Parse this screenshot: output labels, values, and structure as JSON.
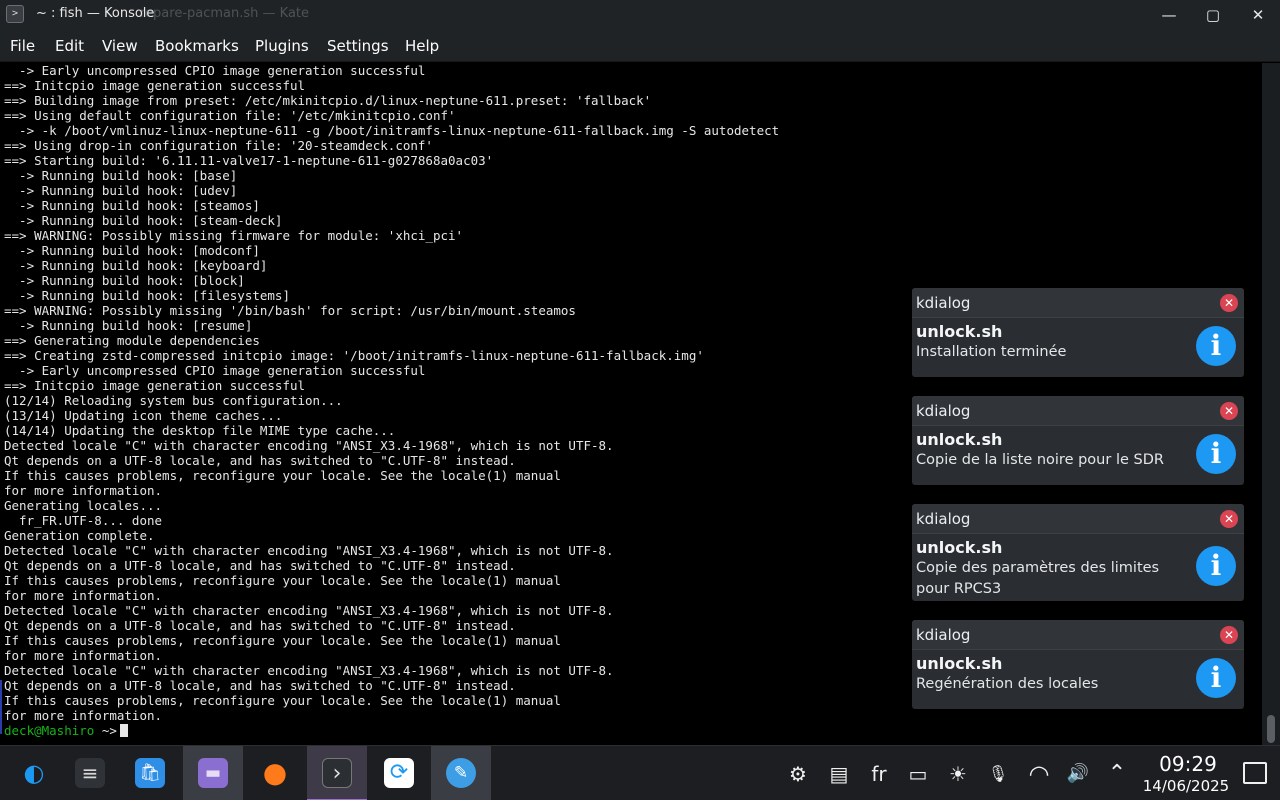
{
  "window": {
    "title": "~ : fish — Konsole",
    "background_title": "repare-pacman.sh — Kate",
    "controls": {
      "minimize": "—",
      "maximize": "▢",
      "close": "✕"
    }
  },
  "menu": [
    "File",
    "Edit",
    "View",
    "Bookmarks",
    "Plugins",
    "Settings",
    "Help"
  ],
  "terminal": {
    "lines": [
      "  -> Early uncompressed CPIO image generation successful",
      "==> Initcpio image generation successful",
      "==> Building image from preset: /etc/mkinitcpio.d/linux-neptune-611.preset: 'fallback'",
      "==> Using default configuration file: '/etc/mkinitcpio.conf'",
      "  -> -k /boot/vmlinuz-linux-neptune-611 -g /boot/initramfs-linux-neptune-611-fallback.img -S autodetect",
      "==> Using drop-in configuration file: '20-steamdeck.conf'",
      "==> Starting build: '6.11.11-valve17-1-neptune-611-g027868a0ac03'",
      "  -> Running build hook: [base]",
      "  -> Running build hook: [udev]",
      "  -> Running build hook: [steamos]",
      "  -> Running build hook: [steam-deck]",
      "==> WARNING: Possibly missing firmware for module: 'xhci_pci'",
      "  -> Running build hook: [modconf]",
      "  -> Running build hook: [keyboard]",
      "  -> Running build hook: [block]",
      "  -> Running build hook: [filesystems]",
      "==> WARNING: Possibly missing '/bin/bash' for script: /usr/bin/mount.steamos",
      "  -> Running build hook: [resume]",
      "==> Generating module dependencies",
      "==> Creating zstd-compressed initcpio image: '/boot/initramfs-linux-neptune-611-fallback.img'",
      "  -> Early uncompressed CPIO image generation successful",
      "==> Initcpio image generation successful",
      "(12/14) Reloading system bus configuration...",
      "(13/14) Updating icon theme caches...",
      "(14/14) Updating the desktop file MIME type cache...",
      "Detected locale \"C\" with character encoding \"ANSI_X3.4-1968\", which is not UTF-8.",
      "Qt depends on a UTF-8 locale, and has switched to \"C.UTF-8\" instead.",
      "If this causes problems, reconfigure your locale. See the locale(1) manual",
      "for more information.",
      "Generating locales...",
      "  fr_FR.UTF-8... done",
      "Generation complete.",
      "Detected locale \"C\" with character encoding \"ANSI_X3.4-1968\", which is not UTF-8.",
      "Qt depends on a UTF-8 locale, and has switched to \"C.UTF-8\" instead.",
      "If this causes problems, reconfigure your locale. See the locale(1) manual",
      "for more information.",
      "Detected locale \"C\" with character encoding \"ANSI_X3.4-1968\", which is not UTF-8.",
      "Qt depends on a UTF-8 locale, and has switched to \"C.UTF-8\" instead.",
      "If this causes problems, reconfigure your locale. See the locale(1) manual",
      "for more information.",
      "Detected locale \"C\" with character encoding \"ANSI_X3.4-1968\", which is not UTF-8.",
      "Qt depends on a UTF-8 locale, and has switched to \"C.UTF-8\" instead.",
      "If this causes problems, reconfigure your locale. See the locale(1) manual",
      "for more information."
    ],
    "prompt_user": "deck@Mashiro",
    "prompt_rest": " ~>"
  },
  "notifications": [
    {
      "app": "kdialog",
      "title": "unlock.sh",
      "message": "Installation terminée"
    },
    {
      "app": "kdialog",
      "title": "unlock.sh",
      "message": "Copie de la liste noire pour le SDR"
    },
    {
      "app": "kdialog",
      "title": "unlock.sh",
      "message": "Copie des paramètres des limites pour RPCS3"
    },
    {
      "app": "kdialog",
      "title": "unlock.sh",
      "message": "Regénération des locales"
    }
  ],
  "notification_close_glyph": "✕",
  "notification_info_glyph": "i",
  "taskbar": {
    "tasks": [
      {
        "name": "application-launcher-icon",
        "glyph": "◐",
        "color": "#1d99f3"
      },
      {
        "name": "system-settings-icon",
        "glyph": "≡",
        "color": "#d8d8d8"
      },
      {
        "name": "discover-store-icon",
        "glyph": "🛍",
        "color": "#2f8ee6"
      },
      {
        "name": "dolphin-file-manager-icon",
        "glyph": "▬",
        "color": "#8a6fd1"
      },
      {
        "name": "firefox-icon",
        "glyph": "●",
        "color": "#ff7a1a"
      },
      {
        "name": "konsole-icon",
        "glyph": "›",
        "color": "#d8d8d8"
      },
      {
        "name": "update-icon",
        "glyph": "⟳",
        "color": "#1d99f3"
      },
      {
        "name": "kate-icon",
        "glyph": "✎",
        "color": "#3d9ee6"
      }
    ],
    "tray": {
      "steam_glyph": "⚙",
      "clipboard_glyph": "▤",
      "keyboard_layout": "fr",
      "battery_glyph": "▭",
      "brightness_glyph": "☀",
      "mic_muted_glyph": "🎙",
      "wifi_glyph": "◠",
      "volume_glyph": "🔊",
      "expand_glyph": "⌃"
    },
    "clock_time": "09:29",
    "clock_date": "14/06/2025"
  }
}
